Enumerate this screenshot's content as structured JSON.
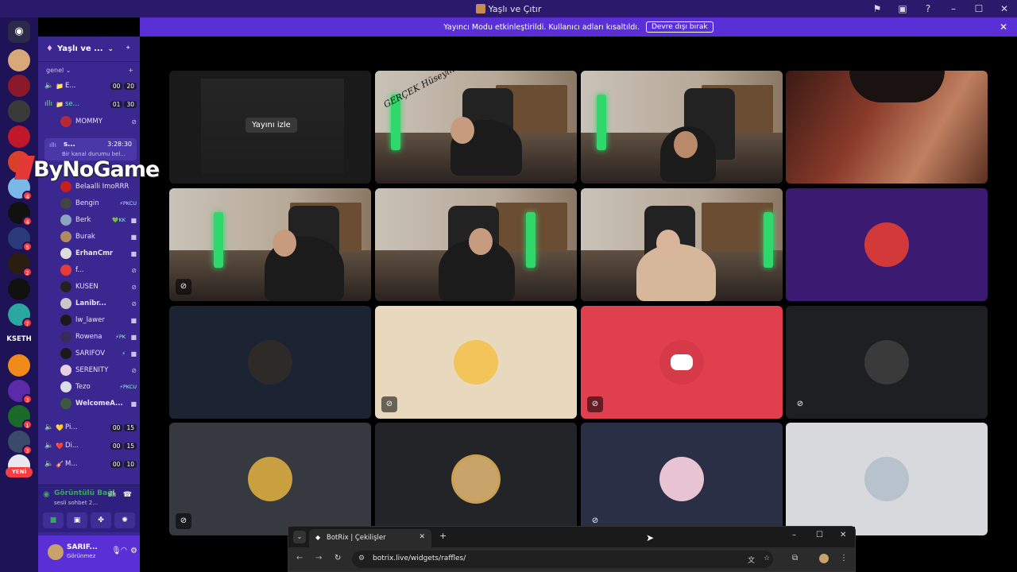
{
  "window": {
    "title": "Yaşlı ve Çıtır"
  },
  "banner": {
    "text": "Yayıncı Modu etkinleştirildi. Kullanıcı adları kısaltıldı.",
    "button": "Devre dışı bırak"
  },
  "server": {
    "name": "Yaşlı ve ...",
    "category": "genel"
  },
  "rail": {
    "kseth": "KSETH",
    "yeni": "YENİ",
    "badges": [
      "4",
      "4",
      "5",
      "2",
      "7",
      "3",
      "1",
      "3"
    ]
  },
  "channels": [
    {
      "emoji": "📁",
      "name": "E...",
      "a": "00",
      "b": "20"
    },
    {
      "emoji": "📁",
      "name": "se...",
      "a": "01",
      "b": "30"
    }
  ],
  "mommy": "MOMMY",
  "live": {
    "name": "s...",
    "time": "3:28:30",
    "status": "Bir kanal durumu bel..."
  },
  "watermark": "ByNoGame",
  "users": [
    {
      "name": "Belaalli ImoRRR",
      "tag": ""
    },
    {
      "name": "Bengin",
      "tag": "⚡PKCU"
    },
    {
      "name": "Berk",
      "tag": "💚KK"
    },
    {
      "name": "Burak",
      "tag": ""
    },
    {
      "name": "ErhanCmr",
      "tag": ""
    },
    {
      "name": "f...",
      "tag": ""
    },
    {
      "name": "KUSEN",
      "tag": ""
    },
    {
      "name": "Lanibr...",
      "tag": ""
    },
    {
      "name": "lw_lawer",
      "tag": ""
    },
    {
      "name": "Rowena",
      "tag": "⚡PK"
    },
    {
      "name": "SARIFOV",
      "tag": "⚡"
    },
    {
      "name": "SERENİTY",
      "tag": ""
    },
    {
      "name": "Tezo",
      "tag": "⚡PKCU"
    },
    {
      "name": "WelcomeA...",
      "tag": ""
    }
  ],
  "channels2": [
    {
      "emoji": "💛",
      "name": "Pi...",
      "a": "00",
      "b": "15"
    },
    {
      "emoji": "❤️",
      "name": "Di...",
      "a": "00",
      "b": "15"
    },
    {
      "emoji": "🎸",
      "name": "M...",
      "a": "00",
      "b": "10"
    }
  ],
  "voice": {
    "status": "Görüntülü Bağl",
    "channel": "sesli sohbet 2..."
  },
  "me": {
    "name": "SARIF...",
    "status": "Görünmez"
  },
  "stage": {
    "watch_label": "Yayını izle"
  },
  "tiles": [
    {
      "kind": "stream"
    },
    {
      "kind": "cam",
      "speaking": true,
      "handwriting": "GERÇEK Hüseyin"
    },
    {
      "kind": "cam"
    },
    {
      "kind": "photo"
    },
    {
      "kind": "cam",
      "mute": true
    },
    {
      "kind": "cam"
    },
    {
      "kind": "cam",
      "speaking": true
    },
    {
      "kind": "avatar",
      "bg": "#3b1a72",
      "av": "#d23a3a"
    },
    {
      "kind": "avatar",
      "bg": "#1c2433",
      "av": "#2e2a28"
    },
    {
      "kind": "avatar",
      "bg": "#e8d8bd",
      "av": "#f2c45a",
      "mute": true
    },
    {
      "kind": "avatar",
      "bg": "#e0404e",
      "av": "#d63a48",
      "mute": true
    },
    {
      "kind": "avatar",
      "bg": "#1e1f22",
      "av": "#3a3a3a",
      "mute": true
    },
    {
      "kind": "avatar",
      "bg": "#36393f",
      "av": "#c8a040",
      "mute": true
    },
    {
      "kind": "avatar",
      "bg": "#232428",
      "av": "#c8a36a"
    },
    {
      "kind": "avatar",
      "bg": "#2a2f45",
      "av": "#e8c4d2",
      "mute": true
    },
    {
      "kind": "avatar",
      "bg": "#d8d9dd",
      "av": "#b8c2cc"
    }
  ],
  "browser": {
    "tab_title": "BotRix | Çekilişler",
    "url": "botrix.live/widgets/raffles/"
  }
}
